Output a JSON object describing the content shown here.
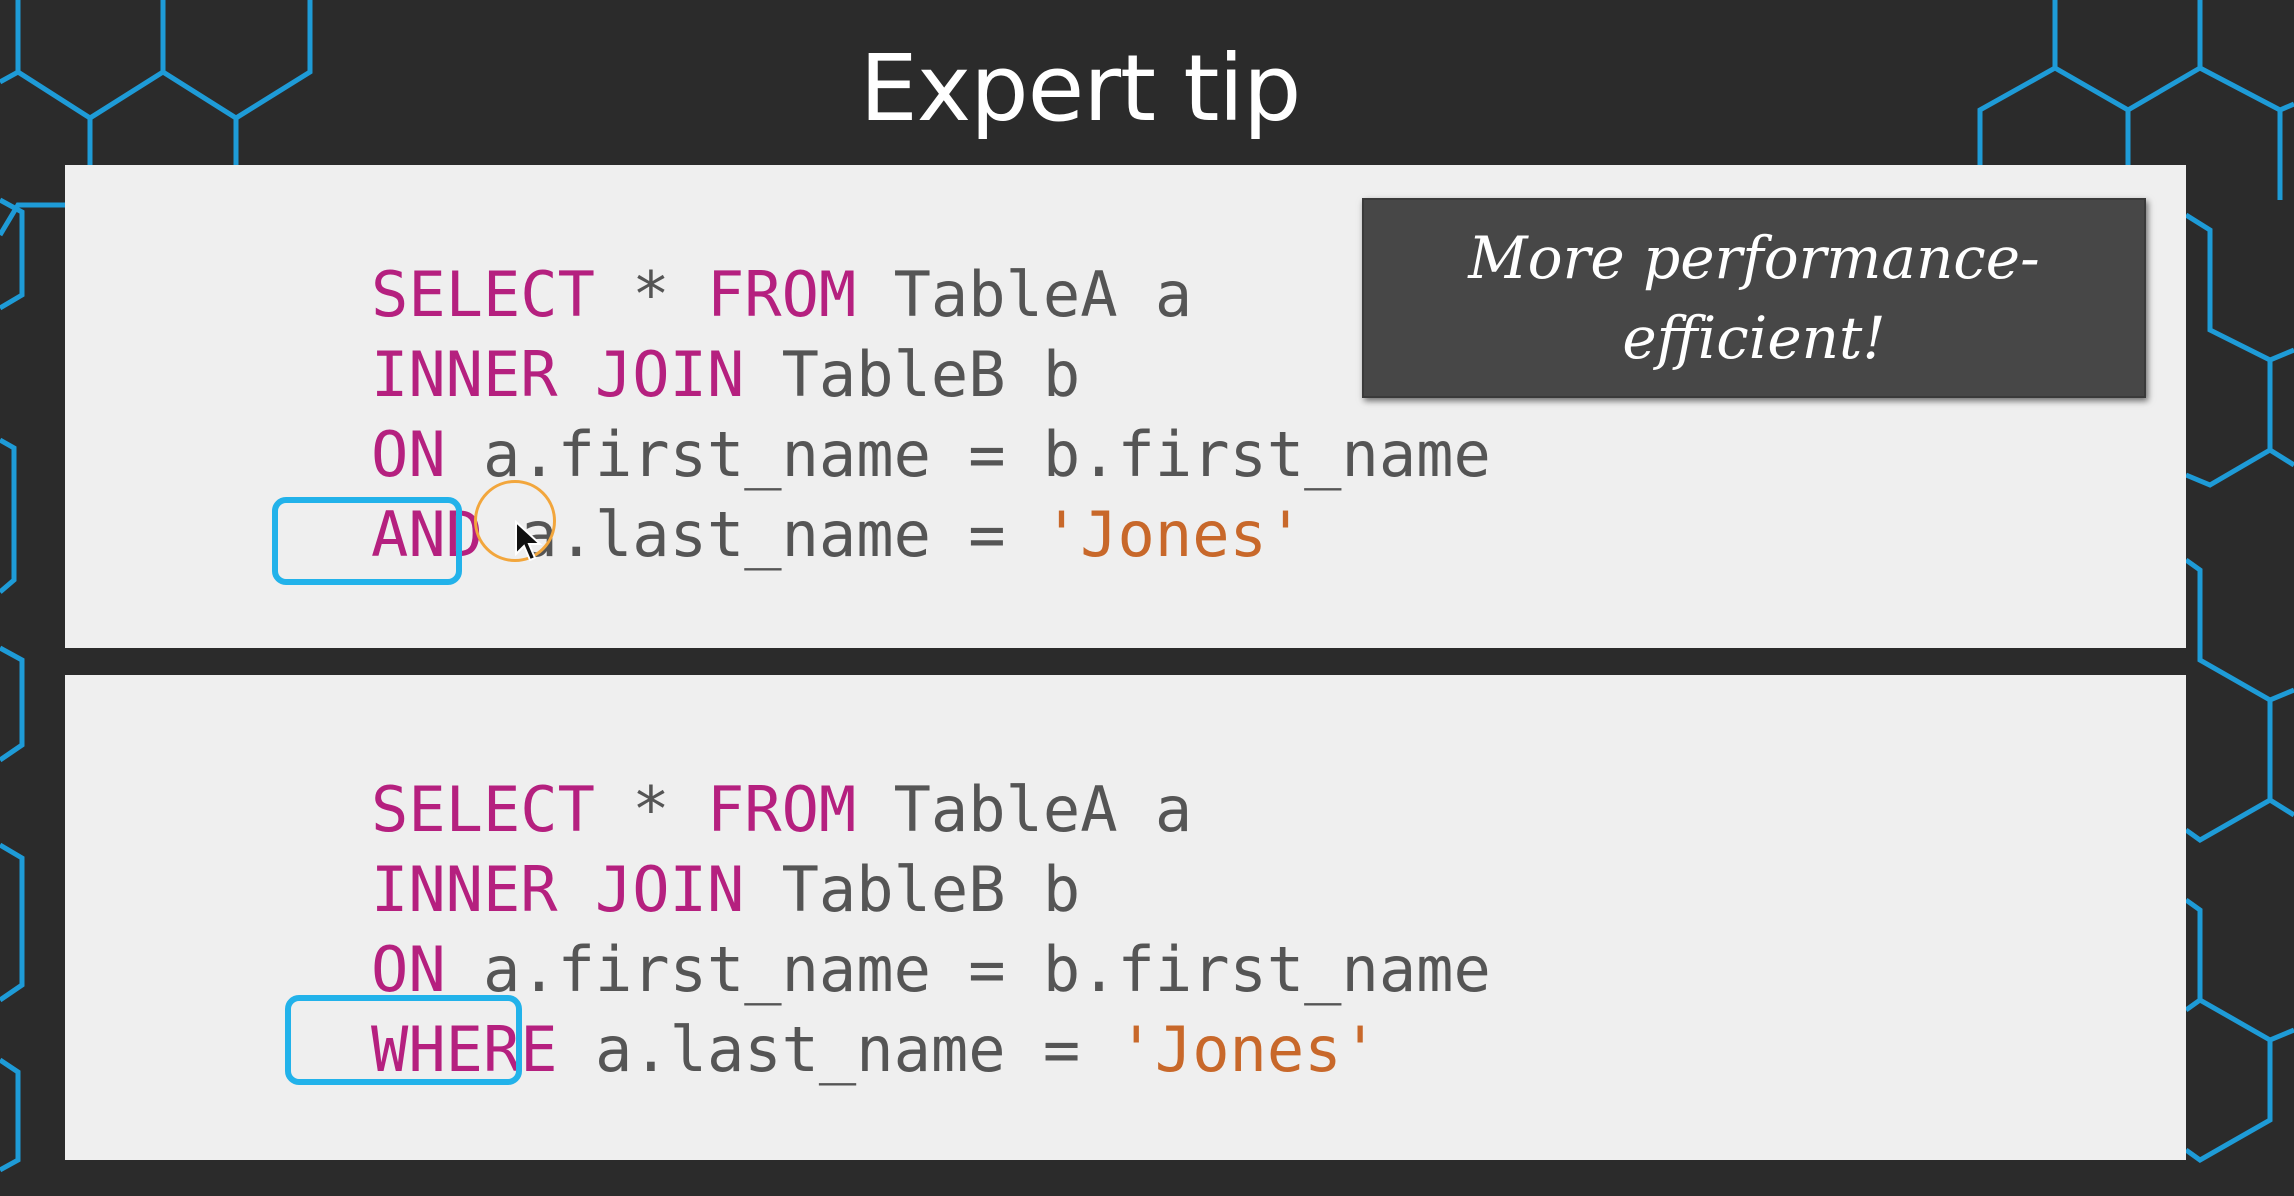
{
  "slide": {
    "title": "Expert tip"
  },
  "callout": {
    "text": "More performance-efficient!"
  },
  "query_1": {
    "line1": {
      "kw1": "SELECT",
      "star": " * ",
      "kw2": "FROM",
      "rest": " TableA a"
    },
    "line2": {
      "kw": "INNER JOIN",
      "rest": " TableB b"
    },
    "line3": {
      "kw": "ON",
      "rest": " a.first_name = b.first_name"
    },
    "line4": {
      "kw": "AND",
      "rest": " a.last_name = ",
      "str": "'Jones'"
    }
  },
  "query_2": {
    "line1": {
      "kw1": "SELECT",
      "star": " * ",
      "kw2": "FROM",
      "rest": " TableA a"
    },
    "line2": {
      "kw": "INNER JOIN",
      "rest": " TableB b"
    },
    "line3": {
      "kw": "ON",
      "rest": " a.first_name = b.first_name"
    },
    "line4": {
      "kw": "WHERE",
      "rest": " a.last_name = ",
      "str": "'Jones'"
    }
  },
  "colors": {
    "background": "#2b2b2b",
    "hexagon_accent": "#1e9bd7",
    "keyword": "#b5207f",
    "string": "#c8682a",
    "highlight_box": "#22b2ea",
    "cursor_ring": "#f2a63c"
  }
}
